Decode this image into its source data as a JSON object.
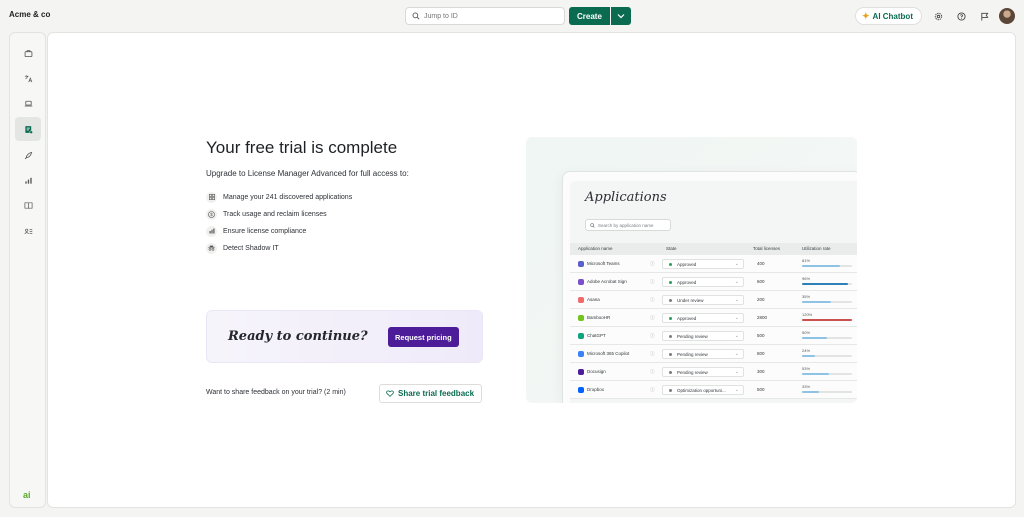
{
  "topbar": {
    "org_name": "Acme & co",
    "search_placeholder": "Jump to ID",
    "create_label": "Create",
    "chatbot_label": "AI Chatbot"
  },
  "sidebar": {
    "icons": [
      "briefcase-icon",
      "translate-icon",
      "laptop-icon",
      "license-icon",
      "rocket-icon",
      "chart-icon",
      "book-icon",
      "people-icon"
    ],
    "active_index": 3,
    "brand": "ai"
  },
  "main": {
    "title": "Your free trial is complete",
    "subtitle": "Upgrade to License Manager Advanced for full access to:",
    "features": [
      {
        "icon": "grid-icon",
        "text": "Manage your 241 discovered applications"
      },
      {
        "icon": "dollar-icon",
        "text": "Track usage and reclaim licenses"
      },
      {
        "icon": "compliance-icon",
        "text": "Ensure license compliance"
      },
      {
        "icon": "spy-icon",
        "text": "Detect Shadow IT"
      }
    ],
    "cta": {
      "text": "Ready to continue?",
      "button": "Request pricing"
    },
    "feedback": {
      "question": "Want to share feedback on your trial? (2 min)",
      "button": "Share trial feedback"
    }
  },
  "preview": {
    "title": "Applications",
    "search_placeholder": "Search by application name",
    "columns": [
      "Application name",
      "State",
      "Total licenses",
      "Utilization rate"
    ],
    "rows": [
      {
        "name": "Microsoft Teams",
        "icon_color": "#5b5fc7",
        "state": "Approved",
        "dot": "#2e9e5a",
        "total": "400",
        "util": "81%",
        "fraction": 0.76,
        "bar": "#8fc3e6"
      },
      {
        "name": "Adobe Acrobat Sign",
        "icon_color": "#7b4fc9",
        "state": "Approved",
        "dot": "#2e9e5a",
        "total": "600",
        "util": "96%",
        "fraction": 0.92,
        "bar": "#2d7fb8"
      },
      {
        "name": "Asana",
        "icon_color": "#f06a6a",
        "state": "Under review",
        "dot": "#7a7e83",
        "total": "200",
        "util": "35%",
        "fraction": 0.58,
        "bar": "#8fc3e6"
      },
      {
        "name": "BambooHR",
        "icon_color": "#73c41d",
        "state": "Approved",
        "dot": "#2e9e5a",
        "total": "2800",
        "util": "120%",
        "fraction": 1.0,
        "bar": "#c9504f"
      },
      {
        "name": "ChatGPT",
        "icon_color": "#10a37f",
        "state": "Pending review",
        "dot": "#7a7e83",
        "total": "500",
        "util": "50%",
        "fraction": 0.5,
        "bar": "#8fc3e6"
      },
      {
        "name": "Microsoft 365 Copilot",
        "icon_color": "#3b82f6",
        "state": "Pending review",
        "dot": "#7a7e83",
        "total": "800",
        "util": "24%",
        "fraction": 0.26,
        "bar": "#8fc3e6"
      },
      {
        "name": "Docusign",
        "icon_color": "#4c1c99",
        "state": "Pending review",
        "dot": "#7a7e83",
        "total": "300",
        "util": "53%",
        "fraction": 0.53,
        "bar": "#8fc3e6"
      },
      {
        "name": "Dropbox",
        "icon_color": "#0061fe",
        "state": "Optimization opportuni...",
        "dot": "#7a7e83",
        "total": "500",
        "util": "33%",
        "fraction": 0.34,
        "bar": "#8fc3e6"
      }
    ]
  }
}
